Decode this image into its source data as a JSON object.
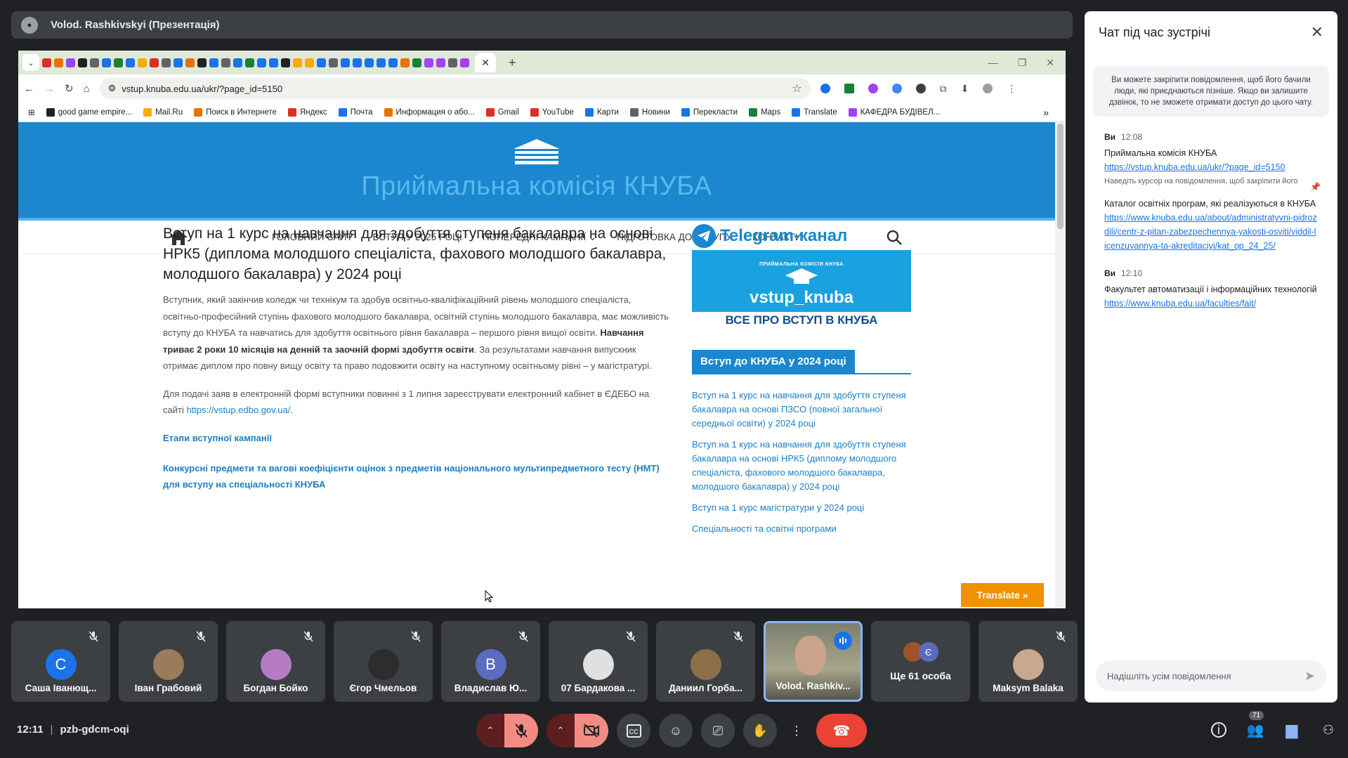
{
  "presenter": {
    "title": "Volod. Rashkivskyi (Презентація)"
  },
  "browser": {
    "url": "vstup.knuba.edu.ua/ukr/?page_id=5150",
    "bookmarks": [
      "good game empire...",
      "Mail.Ru",
      "Поиск в Интернете",
      "Яндекс",
      "Почта",
      "Информация о або...",
      "Gmail",
      "YouTube",
      "Карти",
      "Новини",
      "Перекласти",
      "Maps",
      "Translate",
      "КАФЕДРА БУДІВЕЛ..."
    ],
    "more_label": "»",
    "tab_close": "✕",
    "new_tab": "+"
  },
  "site": {
    "title": "Приймальна комісія КНУБА",
    "nav": [
      "ГОЛОВНИЙ САЙТ",
      "ВСТУП У 2025 РОЦІ",
      "ПОПЕРЕДНІ КАМПАНІЇ",
      "ПІДГОТОВКА ДО ВСТУПУ",
      "КОНТАКТИ"
    ],
    "article": {
      "heading": "Вступ на 1 курс на навчання для здобуття ступеня бакалавра на основі НРК5 (диплома молодшого спеціаліста, фахового молодшого бакалавра, молодшого бакалавра) у 2024 році",
      "p1_start": "Вступник, який закінчив коледж чи технікум та здобув освітньо-кваліфікаційний рівень молодшого спеціаліста, освітньо-професійний ступінь фахового молодшого бакалавра, освітній ступінь молодшого бакалавра, має можливість вступу до КНУБА  та  навчатись для здобуття освітнього рівня бакалавра – першого рівня вищої освіти. ",
      "p1_bold": "Навчання триває  2 роки 10 місяців на денній та заочній формі здобуття освіти",
      "p1_end": ". За результатами навчання випускник отримає диплом про повну вищу освіту та право подовжити освіту на наступному освітньому рівні – у магістратурі.",
      "p2_start": "Для подачі заяв в електронній формі вступники повинні з 1 липня зареєструвати електронний кабінет в ЄДЕБО на сайті ",
      "p2_link": "https://vstup.edbo.gov.ua/",
      "p2_end": ".",
      "link1": "Етапи вступної кампанії",
      "link2": "Конкурсні предмети та вагові коефіцієнти оцінок з предметів національного мультипредметного тесту (НМТ) для вступу на спеціальності КНУБА"
    },
    "sidebar": {
      "tg_title": "Telegram-канал",
      "tg_seal_text": "ПРИЙМАЛЬНА КОМІСІЯ КНУБА",
      "tg_handle": "vstup_knuba",
      "tg_bottom": "ВСЕ ПРО ВСТУП В КНУБА",
      "head": "Вступ до КНУБА у 2024 році",
      "links": [
        "Вступ на 1 курс на навчання для здобуття ступеня бакалавра на основі ПЗСО (повної загальної середньої освіти) у 2024 році",
        "Вступ на 1 курс на навчання для здобуття ступеня бакалавра на основі НРК5 (диплому молодшого спеціаліста, фахового молодшого бакалавра, молодшого бакалавра) у 2024 році",
        "Вступ на 1 курс магістратури у 2024 році",
        "Спеціальності та освітні програми"
      ]
    },
    "translate_button": "Translate »"
  },
  "chat": {
    "title": "Чат під час зустрічі",
    "note": "Ви можете закріпити повідомлення, щоб його бачили люди, які приєднаються пізніше. Якщо ви залишите дзвінок, то не зможете отримати доступ до цього чату.",
    "messages": [
      {
        "sender": "Ви",
        "time": "12:08",
        "line1": "Приймальна комісія КНУБА",
        "link1": "https://vstup.knuba.edu.ua/ukr/?page_id=5150",
        "hint": "Наведіть курсор на повідомлення, щоб закріпити його",
        "line2": "Каталог освітніх програм, які реалізуються в КНУБА",
        "link2": "https://www.knuba.edu.ua/about/administratyvni-pidrozdili/centr-z-pitan-zabezpechennya-yakosti-osviti/viddil-licenzuvannya-ta-akreditaciyi/kat_op_24_25/"
      },
      {
        "sender": "Ви",
        "time": "12:10",
        "text": "Факультет автоматизації і інформаційних технологій ",
        "link": "https://www.knuba.edu.ua/faculties/fait/"
      }
    ],
    "input_placeholder": "Надішліть усім повідомлення"
  },
  "participants": [
    {
      "name": "Саша Іванющ...",
      "initial": "С",
      "color": "#1a73e8",
      "muted": true
    },
    {
      "name": "Іван Грабовий",
      "initial": "",
      "color": "#9a7b5a",
      "muted": true
    },
    {
      "name": "Богдан Бойко",
      "initial": "",
      "color": "#b57cc4",
      "muted": true
    },
    {
      "name": "Єгор Чмельов",
      "initial": "",
      "color": "#2d2d2d",
      "muted": true
    },
    {
      "name": "Владислав Ю...",
      "initial": "В",
      "color": "#5c6bc0",
      "muted": true
    },
    {
      "name": "07 Бардакова ...",
      "initial": "",
      "color": "#e0e0e0",
      "muted": true
    },
    {
      "name": "Даниил Горба...",
      "initial": "",
      "color": "#8d6e4a",
      "muted": true
    },
    {
      "name": "Volod. Rashkiv...",
      "initial": "",
      "color": "#6b6b5e",
      "muted": false,
      "active": true
    },
    {
      "name": "Ще 61 особа",
      "more": true,
      "extra_initial": "Є"
    },
    {
      "name": "Maksym Balaka",
      "initial": "",
      "color": "#c8a88e",
      "muted": true
    }
  ],
  "meeting": {
    "time": "12:11",
    "code": "pzb-gdcm-oqi",
    "people_count": "71"
  }
}
